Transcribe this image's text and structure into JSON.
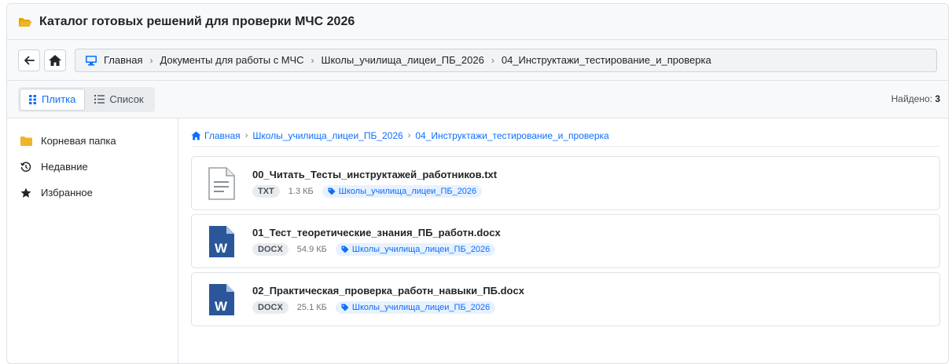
{
  "app": {
    "title": "Каталог готовых решений для проверки МЧС 2026",
    "title_icon": "folder-open-icon"
  },
  "nav": {
    "path": [
      "Главная",
      "Документы для работы с МЧС",
      "Школы_училища_лицеи_ПБ_2026",
      "04_Инструктажи_тестирование_и_проверка"
    ]
  },
  "toolbar": {
    "tile_label": "Плитка",
    "list_label": "Список",
    "found_label": "Найдено:",
    "found_count": "3"
  },
  "sidebar": {
    "items": [
      {
        "label": "Корневая папка",
        "icon": "folder-icon"
      },
      {
        "label": "Недавние",
        "icon": "history-icon"
      },
      {
        "label": "Избранное",
        "icon": "star-icon"
      }
    ]
  },
  "breadcrumb": {
    "items": [
      "Главная",
      "Школы_училища_лицеи_ПБ_2026",
      "04_Инструктажи_тестирование_и_проверка"
    ]
  },
  "files": [
    {
      "name": "00_Читать_Тесты_инструктажей_работников.txt",
      "ext": "TXT",
      "size": "1.3 КБ",
      "tag": "Школы_училища_лицеи_ПБ_2026",
      "icon": "text-file-icon"
    },
    {
      "name": "01_Тест_теоретические_знания_ПБ_работн.docx",
      "ext": "DOCX",
      "size": "54.9 КБ",
      "tag": "Школы_училища_лицеи_ПБ_2026",
      "icon": "word-file-icon"
    },
    {
      "name": "02_Практическая_проверка_работн_навыки_ПБ.docx",
      "ext": "DOCX",
      "size": "25.1 КБ",
      "tag": "Школы_училища_лицеи_ПБ_2026",
      "icon": "word-file-icon"
    }
  ],
  "colors": {
    "accent": "#0d6efd",
    "folder": "#f0b429",
    "word": "#2b579a"
  }
}
